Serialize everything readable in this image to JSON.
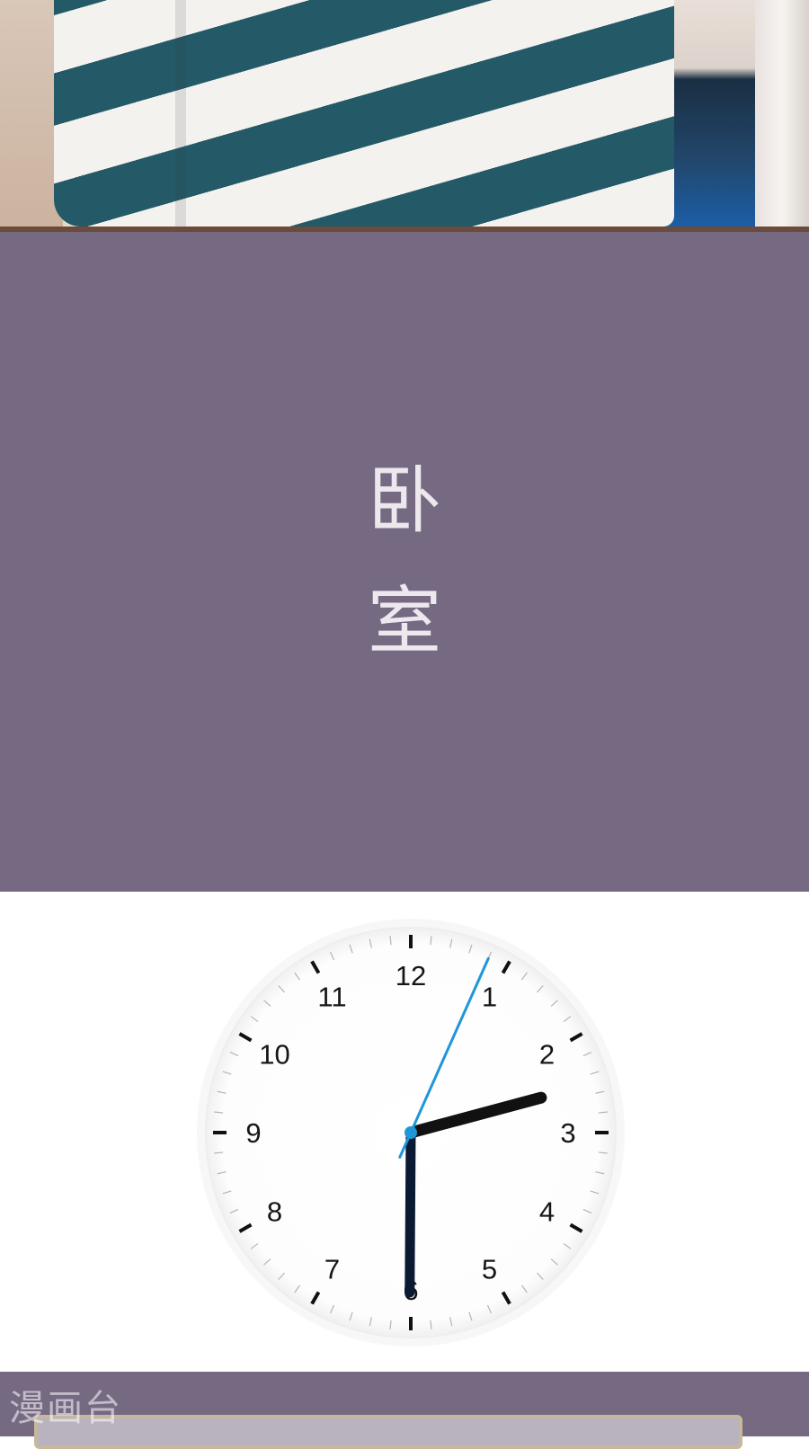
{
  "scene": {
    "title_chars": [
      "卧",
      "室"
    ]
  },
  "clock": {
    "numbers": [
      "12",
      "1",
      "2",
      "3",
      "4",
      "5",
      "6",
      "7",
      "8",
      "9",
      "10",
      "11"
    ],
    "time": {
      "hour": 3,
      "minute": 30,
      "second": 4
    },
    "colors": {
      "hands": "#111111",
      "minute_hand": "#0b1a33",
      "second_hand": "#1f96d8",
      "face": "#ffffff",
      "ticks": "#111111"
    }
  },
  "watermark": {
    "text": "漫画台"
  },
  "colors": {
    "title_panel": "#766a83",
    "title_text": "#ece8ee",
    "border": "#6b4b3b"
  }
}
